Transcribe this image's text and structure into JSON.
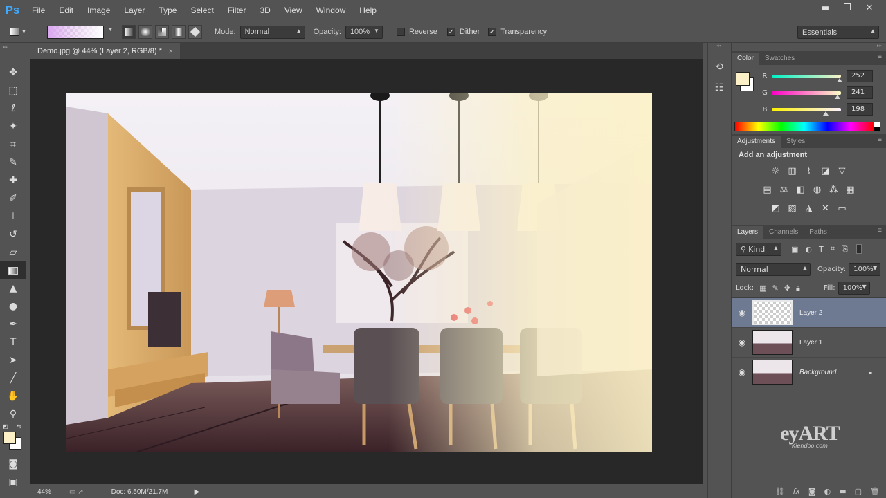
{
  "app": {
    "logo": "Ps"
  },
  "menu": [
    "File",
    "Edit",
    "Image",
    "Layer",
    "Type",
    "Select",
    "Filter",
    "3D",
    "View",
    "Window",
    "Help"
  ],
  "window_controls": {
    "minimize": "▬",
    "restore": "❐",
    "close": "✕"
  },
  "options": {
    "mode_label": "Mode:",
    "mode_value": "Normal",
    "opacity_label": "Opacity:",
    "opacity_value": "100%",
    "reverse_label": "Reverse",
    "dither_label": "Dither",
    "transparency_label": "Transparency",
    "workspace": "Essentials",
    "checked": {
      "reverse": false,
      "dither": true,
      "transparency": true
    }
  },
  "document": {
    "tab_title": "Demo.jpg @ 44% (Layer 2, RGB/8) *",
    "close_glyph": "×"
  },
  "status": {
    "zoom": "44%",
    "doc_size": "Doc: 6.50M/21.7M"
  },
  "color_panel": {
    "tabs": [
      "Color",
      "Swatches"
    ],
    "r_label": "R",
    "g_label": "G",
    "b_label": "B",
    "r": "252",
    "g": "241",
    "b": "198",
    "foreground": "#fcf1c6"
  },
  "adjustments_panel": {
    "tabs": [
      "Adjustments",
      "Styles"
    ],
    "title": "Add an adjustment"
  },
  "layers_panel": {
    "tabs": [
      "Layers",
      "Channels",
      "Paths"
    ],
    "kind_label": "Kind",
    "blend_mode": "Normal",
    "opacity_label": "Opacity:",
    "opacity_value": "100%",
    "lock_label": "Lock:",
    "fill_label": "Fill:",
    "fill_value": "100%",
    "layers": [
      {
        "name": "Layer 2",
        "selected": true
      },
      {
        "name": "Layer 1",
        "selected": false
      },
      {
        "name": "Background",
        "selected": false
      }
    ]
  },
  "watermark": {
    "brand": "eyART",
    "site": "Kiendoo.com"
  }
}
